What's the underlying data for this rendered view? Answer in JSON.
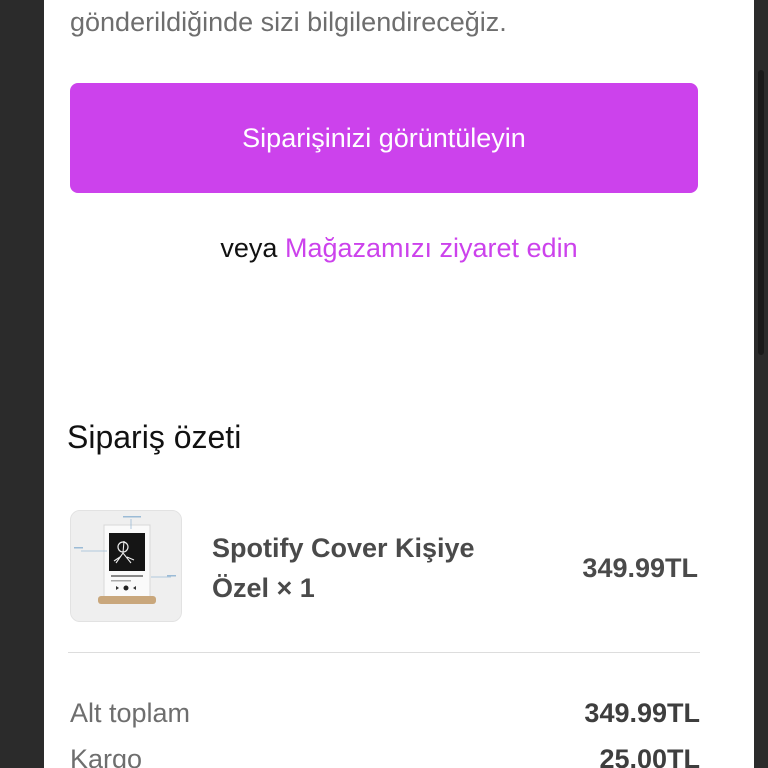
{
  "notice": {
    "text": "gönderildiğinde sizi bilgilendireceğiz."
  },
  "actions": {
    "view_order_label": "Siparişinizi görüntüleyin",
    "or_label": "veya",
    "visit_store_label": "Mağazamızı ziyaret edin"
  },
  "summary": {
    "title": "Sipariş özeti",
    "items": [
      {
        "name": "Spotify Cover Kişiye Özel × 1",
        "price": "349.99TL"
      }
    ],
    "subtotal": {
      "label": "Alt toplam",
      "value": "349.99TL"
    },
    "shipping": {
      "label": "Kargo",
      "value": "25.00TL"
    }
  },
  "colors": {
    "accent": "#cc42ec",
    "frame": "#2b2b2b"
  }
}
